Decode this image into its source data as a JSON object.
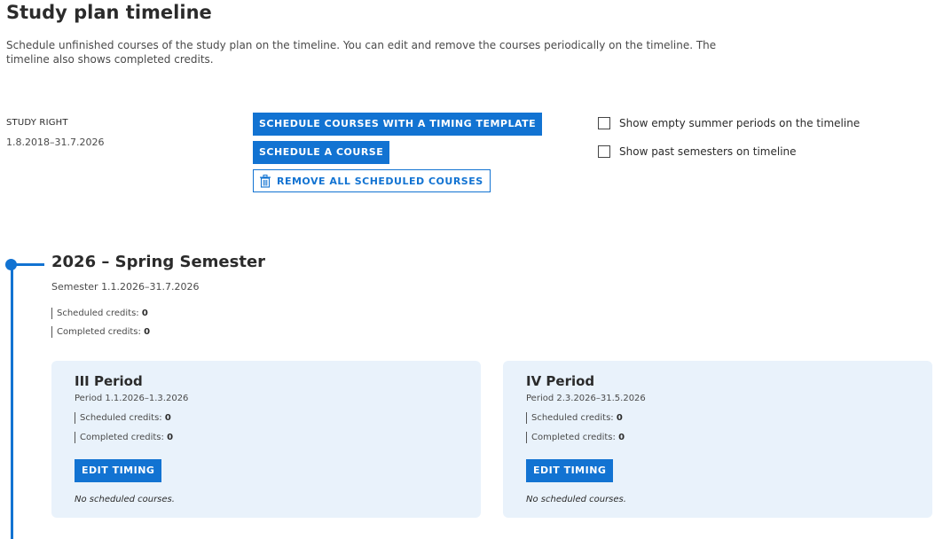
{
  "page": {
    "title": "Study plan timeline",
    "intro": "Schedule unfinished courses of the study plan on the timeline. You can edit and remove the courses periodically on the timeline. The timeline also shows completed credits."
  },
  "study_right": {
    "label": "STUDY RIGHT",
    "dates": "1.8.2018–31.7.2026"
  },
  "actions": {
    "timing_template_label": "SCHEDULE COURSES WITH A TIMING TEMPLATE",
    "schedule_course_label": "SCHEDULE A COURSE",
    "remove_all_label": "REMOVE ALL SCHEDULED COURSES"
  },
  "options": {
    "show_empty_summer": "Show empty summer periods on the timeline",
    "show_past_semesters": "Show past semesters on timeline"
  },
  "semester": {
    "title": "2026 – Spring Semester",
    "dates": "Semester 1.1.2026–31.7.2026",
    "scheduled_label": "Scheduled credits:",
    "scheduled_value": "0",
    "completed_label": "Completed credits:",
    "completed_value": "0"
  },
  "periods": [
    {
      "title": "III Period",
      "dates": "Period 1.1.2026–1.3.2026",
      "scheduled_label": "Scheduled credits:",
      "scheduled_value": "0",
      "completed_label": "Completed credits:",
      "completed_value": "0",
      "edit_label": "EDIT TIMING",
      "empty_text": "No scheduled courses."
    },
    {
      "title": "IV Period",
      "dates": "Period 2.3.2026–31.5.2026",
      "scheduled_label": "Scheduled credits:",
      "scheduled_value": "0",
      "completed_label": "Completed credits:",
      "completed_value": "0",
      "edit_label": "EDIT TIMING",
      "empty_text": "No scheduled courses."
    }
  ],
  "colors": {
    "accent": "#1273d2",
    "card_bg": "#e9f2fb"
  },
  "icons": {
    "remove_all": "trash-icon"
  }
}
